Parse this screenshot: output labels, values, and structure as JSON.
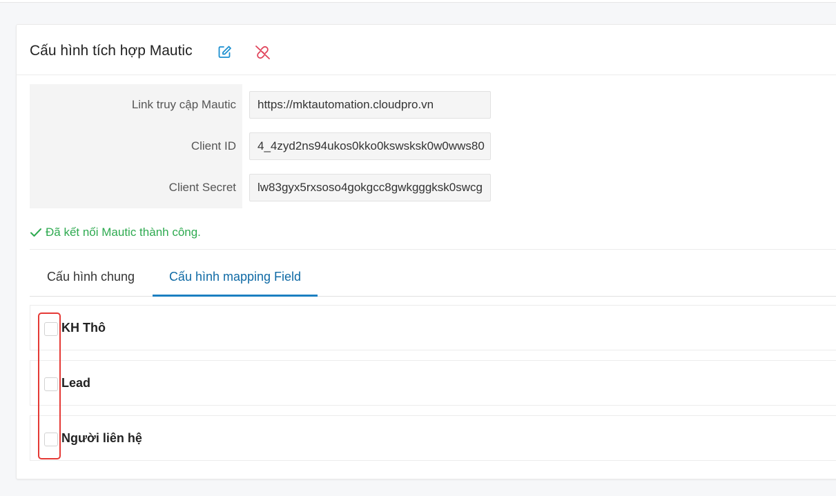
{
  "card": {
    "title": "Cấu hình tích hợp Mautic",
    "edit_icon": "edit-icon",
    "unlink_icon": "unlink-icon",
    "edit_color": "#1b8fd0",
    "unlink_color": "#e0435a"
  },
  "form": {
    "link_label": "Link truy cập Mautic",
    "link_value": "https://mktautomation.cloudpro.vn",
    "client_id_label": "Client ID",
    "client_id_value": "4_4zyd2ns94ukos0kko0kswsksk0w0wws80",
    "client_secret_label": "Client Secret",
    "client_secret_value": "lw83gyx5rxsoso4gokgcc8gwkgggksk0swcg"
  },
  "status": {
    "text": "Đã kết nối Mautic thành công.",
    "icon": "check-icon",
    "color": "#2eaa50"
  },
  "tabs": [
    {
      "label": "Cấu hình chung",
      "active": false
    },
    {
      "label": "Cấu hình mapping Field",
      "active": true
    }
  ],
  "panels": [
    {
      "label": "KH Thô",
      "checked": false
    },
    {
      "label": "Lead",
      "checked": false
    },
    {
      "label": "Người liên hệ",
      "checked": false
    }
  ]
}
